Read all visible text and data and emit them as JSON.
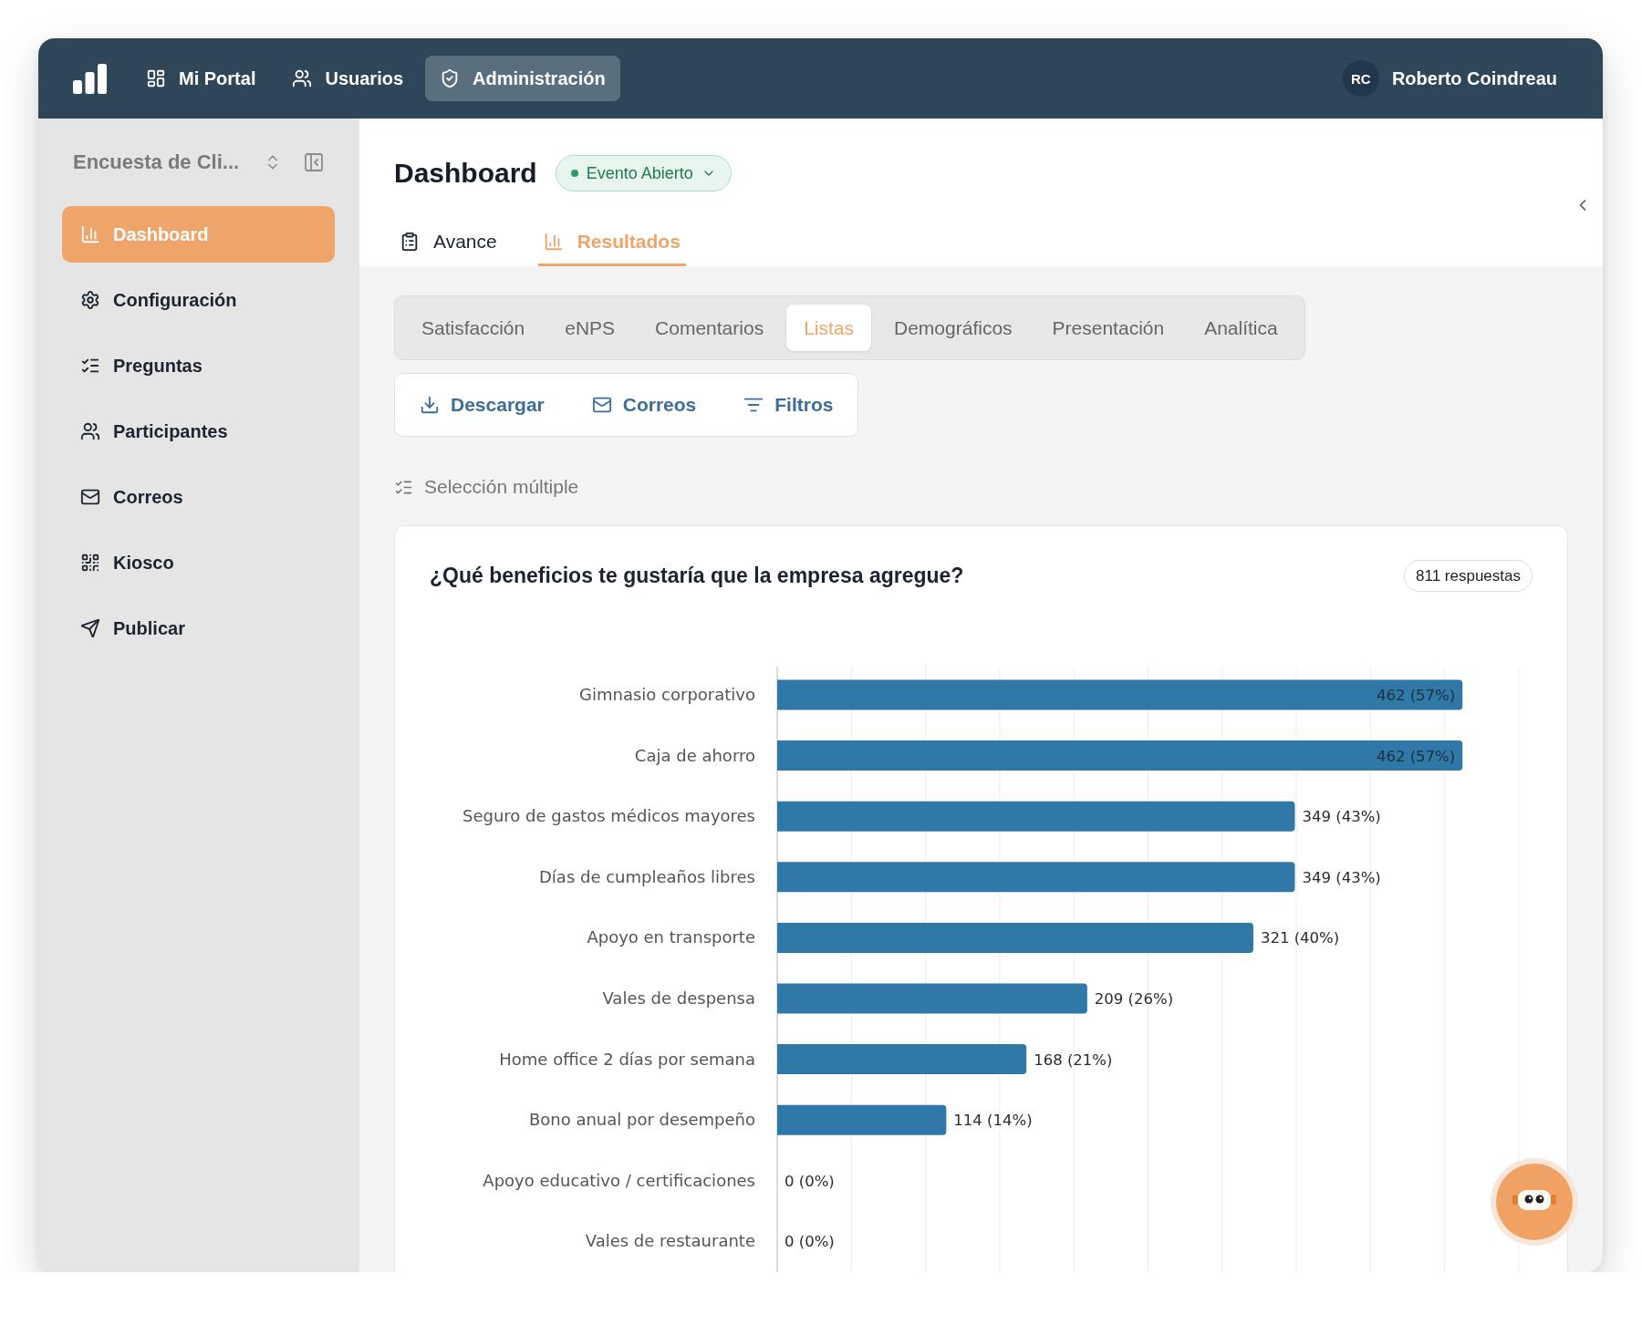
{
  "top_bar": {
    "nav": [
      {
        "label": "Mi Portal",
        "selected": false
      },
      {
        "label": "Usuarios",
        "selected": false
      },
      {
        "label": "Administración",
        "selected": true
      }
    ],
    "user": {
      "initials": "RC",
      "name": "Roberto Coindreau"
    }
  },
  "sidebar": {
    "survey_title": "Encuesta de Cli...",
    "items": [
      {
        "label": "Dashboard",
        "selected": true
      },
      {
        "label": "Configuración",
        "selected": false
      },
      {
        "label": "Preguntas",
        "selected": false
      },
      {
        "label": "Participantes",
        "selected": false
      },
      {
        "label": "Correos",
        "selected": false
      },
      {
        "label": "Kiosco",
        "selected": false
      },
      {
        "label": "Publicar",
        "selected": false
      }
    ]
  },
  "header": {
    "title": "Dashboard",
    "status": {
      "label": "Evento Abierto"
    }
  },
  "view_tabs": [
    {
      "label": "Avance",
      "selected": false
    },
    {
      "label": "Resultados",
      "selected": true
    }
  ],
  "result_tabs": [
    {
      "label": "Satisfacción",
      "selected": false
    },
    {
      "label": "eNPS",
      "selected": false
    },
    {
      "label": "Comentarios",
      "selected": false
    },
    {
      "label": "Listas",
      "selected": true
    },
    {
      "label": "Demográficos",
      "selected": false
    },
    {
      "label": "Presentación",
      "selected": false
    },
    {
      "label": "Analítica",
      "selected": false
    }
  ],
  "actions": [
    "Descargar",
    "Correos",
    "Filtros"
  ],
  "section": {
    "label": "Selección múltiple"
  },
  "question_card": {
    "title": "¿Qué beneficios te gustaría que la empresa agregue?",
    "responses": "811 respuestas",
    "chart_data": {
      "type": "bar",
      "orientation": "horizontal",
      "categories": [
        "Gimnasio corporativo",
        "Caja de ahorro",
        "Seguro de gastos médicos mayores",
        "Días de cumpleaños libres",
        "Apoyo en transporte",
        "Vales de despensa",
        "Home office 2 días por semana",
        "Bono anual por desempeño",
        "Apoyo educativo / certificaciones",
        "Vales de restaurante"
      ],
      "values": [
        462,
        462,
        349,
        349,
        321,
        209,
        168,
        114,
        0,
        0
      ],
      "xlim": [
        0,
        500
      ],
      "value_labels": [
        "462 (57%)",
        "462 (57%)",
        "349 (43%)",
        "349 (43%)",
        "321 (40%)",
        "209 (26%)",
        "168 (21%)",
        "114 (14%)",
        "0 (0%)",
        "0 (0%)"
      ]
    }
  }
}
